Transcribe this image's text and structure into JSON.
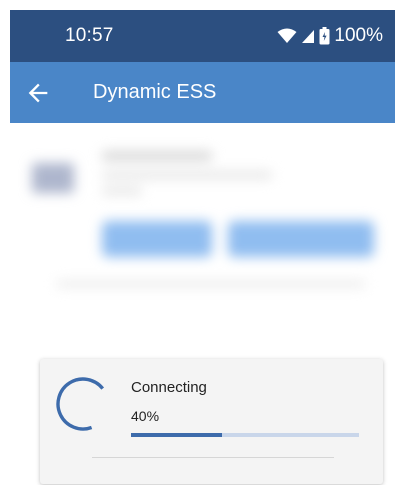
{
  "status_bar": {
    "time": "10:57",
    "battery_percent": "100%",
    "icons": [
      "wifi-icon",
      "cellular-signal-icon",
      "battery-icon"
    ]
  },
  "app_bar": {
    "title": "Dynamic ESS",
    "back_icon": "arrow-back-icon",
    "color": "#4a86c8"
  },
  "status_bar_color": "#2c4f80",
  "dialog": {
    "title": "Connecting",
    "percent_label": "40%",
    "progress": 0.4,
    "progress_color": "#3d6bab",
    "spinner_icon": "loading-spinner-icon"
  }
}
